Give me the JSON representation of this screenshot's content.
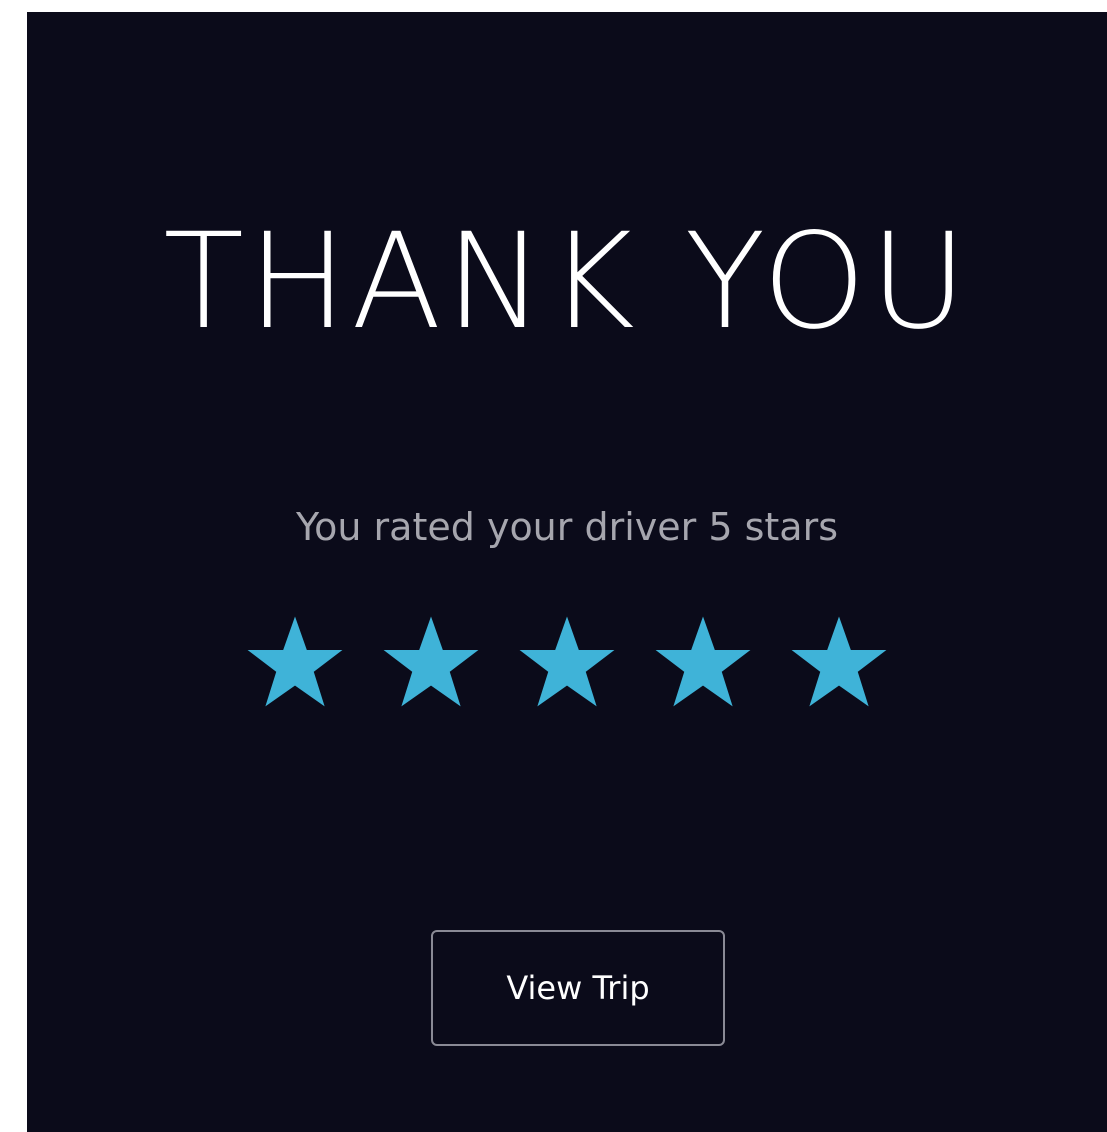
{
  "title": "THANK YOU",
  "subtitle": "You rated your driver 5 stars",
  "rating": {
    "value": 5,
    "max": 5,
    "star_icon": "star-icon",
    "star_color": "#3fb3d8"
  },
  "view_trip_button": {
    "label": "View Trip"
  },
  "colors": {
    "background": "#0b0b1a",
    "title": "#ffffff",
    "subtitle": "#a6a6ae",
    "button_border": "#8a8a95"
  }
}
